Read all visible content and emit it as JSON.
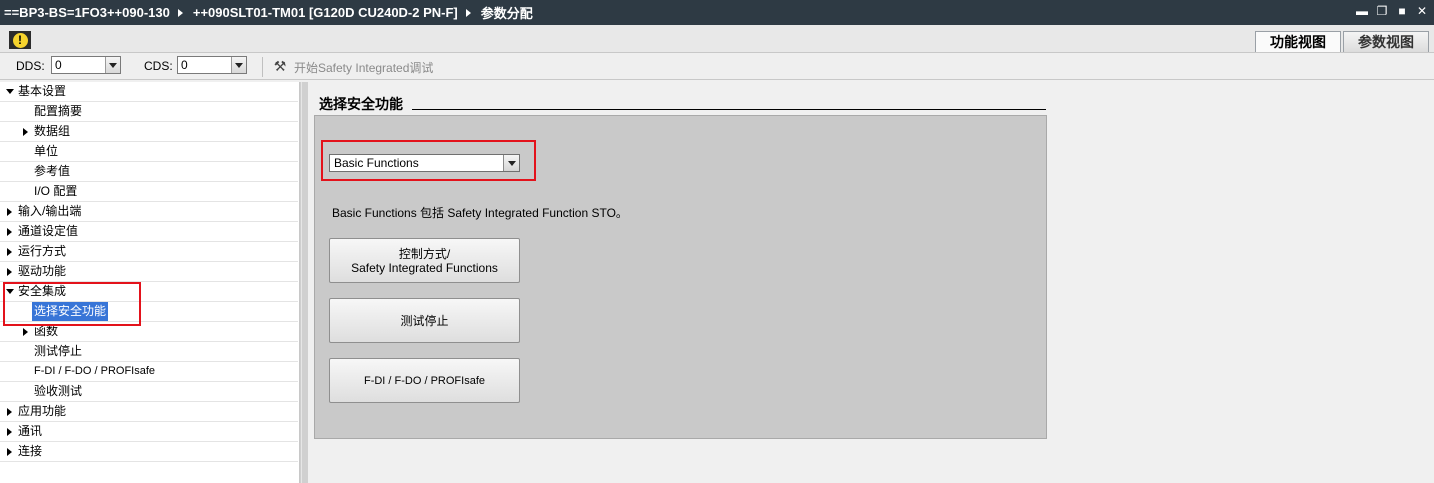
{
  "titlebar": {
    "crumbs": [
      "==BP3-BS=1FO3++090-130",
      "++090SLT01-TM01 [G120D CU240D-2 PN-F]",
      "参数分配"
    ]
  },
  "view_tabs": {
    "function_view": "功能视图",
    "parameter_view": "参数视图"
  },
  "toolbar": {
    "dds_label": "DDS:",
    "dds_value": "0",
    "cds_label": "CDS:",
    "cds_value": "0",
    "start_button": "开始Safety  Integrated调试"
  },
  "tree": {
    "items": [
      {
        "label": "基本设置",
        "state": "expanded"
      },
      {
        "label": "配置摘要",
        "state": "leaf"
      },
      {
        "label": "数据组",
        "state": "collapsed"
      },
      {
        "label": "单位",
        "state": "leaf"
      },
      {
        "label": "参考值",
        "state": "leaf"
      },
      {
        "label": "I/O 配置",
        "state": "leaf"
      },
      {
        "label": "输入/输出端",
        "state": "collapsed"
      },
      {
        "label": "通道设定值",
        "state": "collapsed"
      },
      {
        "label": "运行方式",
        "state": "collapsed"
      },
      {
        "label": "驱动功能",
        "state": "collapsed"
      },
      {
        "label": "安全集成",
        "state": "expanded"
      },
      {
        "label": "选择安全功能",
        "state": "selected"
      },
      {
        "label": "函数",
        "state": "collapsed"
      },
      {
        "label": "测试停止",
        "state": "leaf"
      },
      {
        "label": "F-DI / F-DO / PROFIsafe",
        "state": "leaf"
      },
      {
        "label": "验收测试",
        "state": "leaf"
      },
      {
        "label": "应用功能",
        "state": "collapsed"
      },
      {
        "label": "通讯",
        "state": "collapsed"
      },
      {
        "label": "连接",
        "state": "collapsed"
      }
    ]
  },
  "content": {
    "section_title": "选择安全功能",
    "function_select_value": "Basic Functions",
    "description": "Basic Functions 包括 Safety Integrated Function STO。",
    "buttons": {
      "control_line1": "控制方式/",
      "control_line2": "Safety Integrated Functions",
      "test_stop": "测试停止",
      "fdi": "F-DI / F-DO / PROFIsafe"
    }
  },
  "colors": {
    "highlight_box": "#e3121b",
    "selection": "#3875d7",
    "titlebar": "#2e3a44"
  }
}
